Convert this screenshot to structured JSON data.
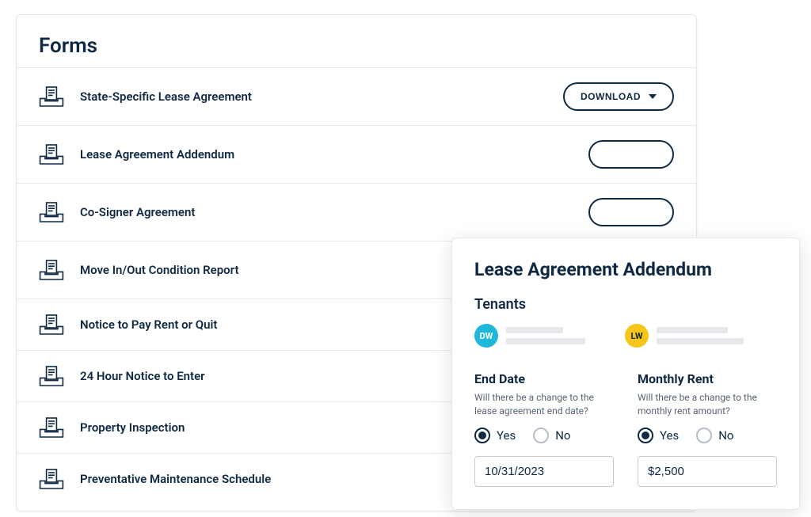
{
  "forms": {
    "title": "Forms",
    "download_label": "DOWNLOAD",
    "items": [
      {
        "name": "State-Specific Lease Agreement",
        "has_download": true
      },
      {
        "name": "Lease Agreement Addendum",
        "has_download": true
      },
      {
        "name": "Co-Signer Agreement",
        "has_download": true
      },
      {
        "name": "Move In/Out Condition Report",
        "has_download": true
      },
      {
        "name": "Notice to Pay Rent or Quit",
        "has_download": false
      },
      {
        "name": "24 Hour Notice to Enter",
        "has_download": false
      },
      {
        "name": "Property Inspection",
        "has_download": false
      },
      {
        "name": "Preventative Maintenance Schedule",
        "has_download": false
      }
    ]
  },
  "addendum": {
    "title": "Lease Agreement Addendum",
    "tenants_label": "Tenants",
    "tenants": [
      {
        "initials": "DW",
        "color": "blue"
      },
      {
        "initials": "LW",
        "color": "yellow"
      }
    ],
    "end_date": {
      "title": "End Date",
      "desc": "Will there be a change to the lease agreement end date?",
      "yes_label": "Yes",
      "no_label": "No",
      "selected": "yes",
      "value": "10/31/2023"
    },
    "monthly_rent": {
      "title": "Monthly Rent",
      "desc": "Will there be a change to the monthly rent amount?",
      "yes_label": "Yes",
      "no_label": "No",
      "selected": "yes",
      "value": "$2,500"
    }
  }
}
